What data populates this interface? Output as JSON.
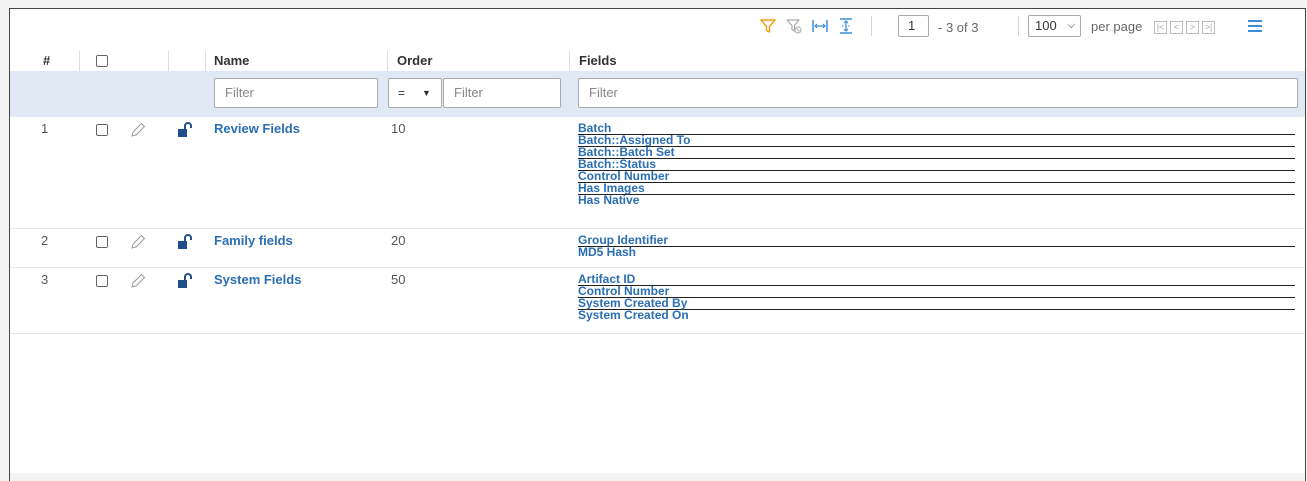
{
  "toolbar": {
    "page_current": "1",
    "page_range": "- 3 of 3",
    "per_page_value": "100",
    "per_page_label": "per page",
    "icons": [
      "filter-icon",
      "clear-filter-icon",
      "fit-columns-icon",
      "expand-rows-icon",
      "menu-icon"
    ],
    "accent_color": "#f39c12"
  },
  "columns": {
    "num": "#",
    "name": "Name",
    "order": "Order",
    "fields": "Fields"
  },
  "filters": {
    "name_placeholder": "Filter",
    "order_operator": "=",
    "order_placeholder": "Filter",
    "fields_placeholder": "Filter"
  },
  "rows": [
    {
      "num": "1",
      "name": "Review Fields",
      "order": "10",
      "fields": [
        "Batch",
        "Batch::Assigned To",
        "Batch::Batch Set",
        "Batch::Status",
        "Control Number",
        "Has Images",
        "Has Native"
      ]
    },
    {
      "num": "2",
      "name": "Family fields",
      "order": "20",
      "fields": [
        "Group Identifier",
        "MD5 Hash"
      ]
    },
    {
      "num": "3",
      "name": "System Fields",
      "order": "50",
      "fields": [
        "Artifact ID",
        "Control Number",
        "System Created By",
        "System Created On"
      ]
    }
  ]
}
